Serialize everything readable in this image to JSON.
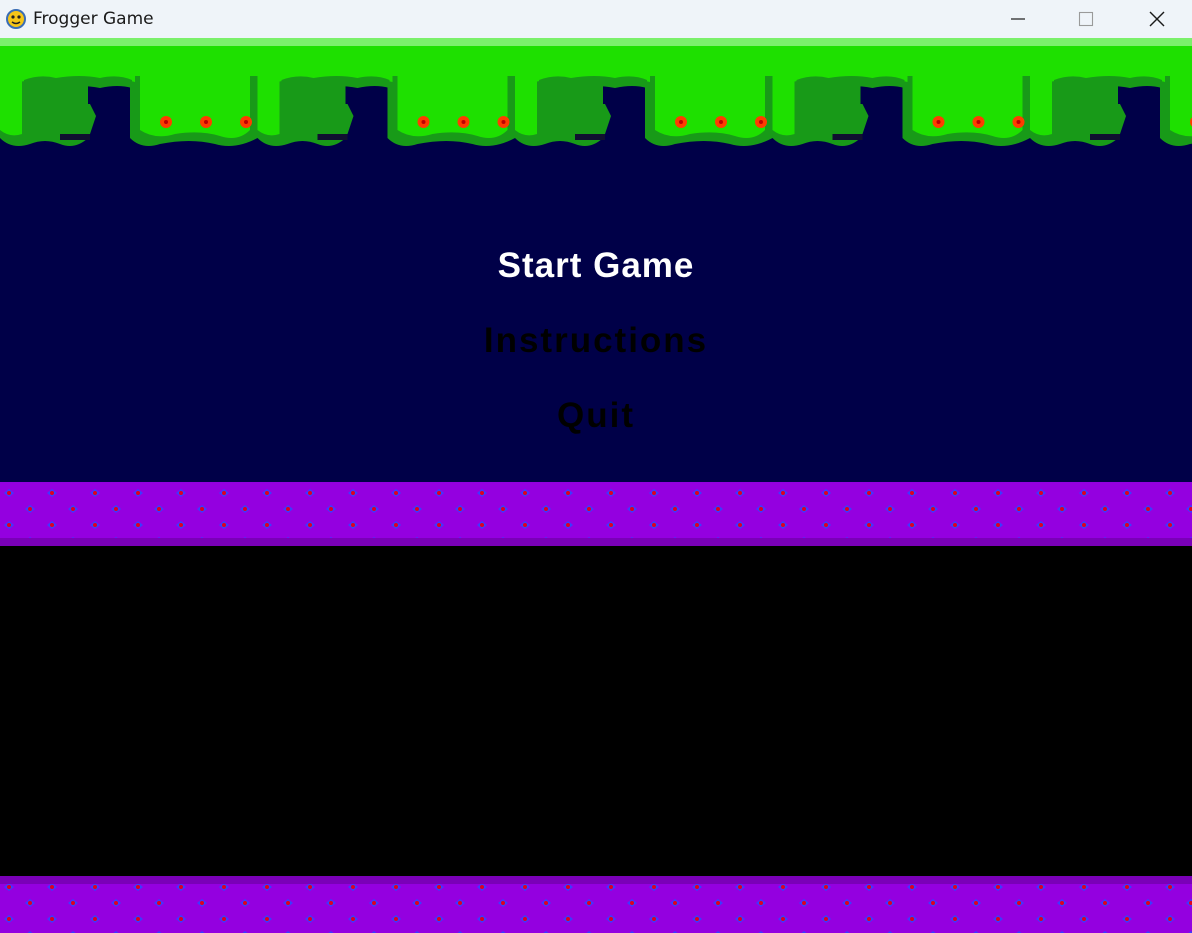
{
  "window": {
    "title": "Frogger Game",
    "icon": "pygame-snake-icon",
    "controls": [
      "minimize-icon",
      "maximize-icon",
      "close-icon"
    ]
  },
  "menu": {
    "items": [
      {
        "label": "Start Game",
        "selected": true
      },
      {
        "label": "Instructions",
        "selected": false
      },
      {
        "label": "Quit",
        "selected": false
      }
    ]
  },
  "colors": {
    "titlebar": "#eff4f9",
    "hedge_light": "#1ee000",
    "hedge_dark": "#189a18",
    "river": "#000048",
    "median": "#9400e0",
    "median_dot_red": "#e0001e",
    "median_dot_blue": "#3b3bff",
    "road": "#000000",
    "menu_selected": "#ffffff",
    "menu_unselected": "#000000"
  }
}
